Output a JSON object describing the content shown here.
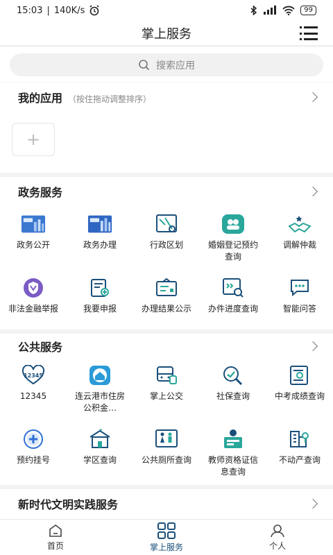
{
  "status": {
    "time": "15:03",
    "speed": "140K/s",
    "battery": "99"
  },
  "header": {
    "title": "掌上服务"
  },
  "search": {
    "placeholder": "搜索应用"
  },
  "my_apps": {
    "title": "我的应用",
    "subtitle": "（按住拖动调整排序）",
    "add": "+"
  },
  "gov": {
    "title": "政务服务",
    "items": [
      {
        "label": "政务公开",
        "icon": "gov-public-icon"
      },
      {
        "label": "政务办理",
        "icon": "gov-affairs-icon"
      },
      {
        "label": "行政区划",
        "icon": "map-division-icon"
      },
      {
        "label": "婚姻登记预约查询",
        "icon": "marriage-icon"
      },
      {
        "label": "调解仲裁",
        "icon": "handshake-icon"
      },
      {
        "label": "非法金融举报",
        "icon": "shield-report-icon"
      },
      {
        "label": "我要申报",
        "icon": "declare-icon"
      },
      {
        "label": "办理结果公示",
        "icon": "result-board-icon"
      },
      {
        "label": "办件进度查询",
        "icon": "progress-search-icon"
      },
      {
        "label": "智能问答",
        "icon": "chat-icon"
      }
    ]
  },
  "public": {
    "title": "公共服务",
    "items": [
      {
        "label": "12345",
        "icon": "hotline-heart-icon"
      },
      {
        "label": "连云港市住房公积金…",
        "icon": "housing-fund-icon"
      },
      {
        "label": "掌上公交",
        "icon": "bus-icon"
      },
      {
        "label": "社保查询",
        "icon": "social-security-icon"
      },
      {
        "label": "中考成绩查询",
        "icon": "exam-score-icon"
      },
      {
        "label": "预约挂号",
        "icon": "hospital-icon"
      },
      {
        "label": "学区查询",
        "icon": "school-icon"
      },
      {
        "label": "公共厕所查询",
        "icon": "toilet-icon"
      },
      {
        "label": "教师资格证信息查询",
        "icon": "teacher-cert-icon"
      },
      {
        "label": "不动产查询",
        "icon": "real-estate-icon"
      }
    ]
  },
  "civil": {
    "title": "新时代文明实践服务"
  },
  "tabs": [
    {
      "label": "首页",
      "icon": "home-icon"
    },
    {
      "label": "掌上服务",
      "icon": "grid-icon"
    },
    {
      "label": "个人",
      "icon": "person-icon"
    }
  ],
  "colors": {
    "accent": "#1a4f7a",
    "teal": "#2aa79b",
    "blue": "#2f6fd6"
  }
}
